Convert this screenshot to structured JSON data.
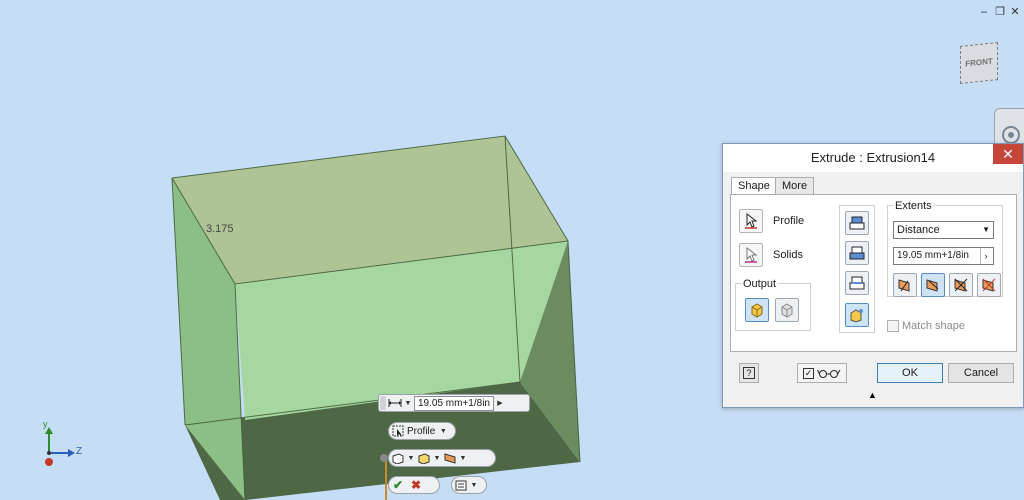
{
  "viewport": {
    "background": "#c6ddf6",
    "dimension_label": "3.175",
    "viewcube_face": "FRONT",
    "triad": {
      "y": "y",
      "z": "Z"
    }
  },
  "window_controls": {
    "minimize": "–",
    "restore": "❐",
    "close": "✕"
  },
  "minitoolbar": {
    "distance_value": "19.05 mm+1/8in",
    "profile_label": "Profile"
  },
  "dialog": {
    "title": "Extrude : Extrusion14",
    "close": "✕",
    "tabs": [
      {
        "label": "Shape",
        "active": true
      },
      {
        "label": "More",
        "active": false
      }
    ],
    "profile_label": "Profile",
    "solids_label": "Solids",
    "output_label": "Output",
    "extents_label": "Extents",
    "extents_value": "Distance",
    "distance_value": "19.05 mm+1/8in",
    "match_shape_label": "Match shape",
    "ok_label": "OK",
    "cancel_label": "Cancel",
    "help_icon": "?",
    "collapse_icon": "▲"
  },
  "colors": {
    "accent": "#4a88c7",
    "dialog_close": "#c7463a",
    "solid_top": "#b3cd9c",
    "solid_side": "#7f9d6e",
    "solid_front": "#a2d49a"
  }
}
